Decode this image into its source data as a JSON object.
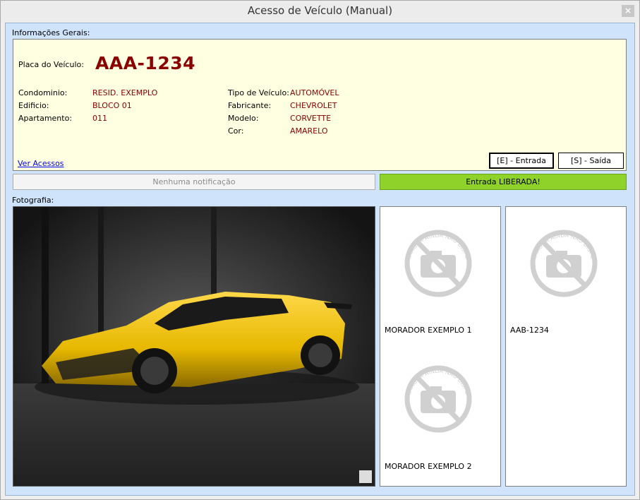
{
  "window": {
    "title": "Acesso de Veículo (Manual)",
    "close_label": "×"
  },
  "info": {
    "section_label": "Informações Gerais:",
    "plate_label": "Placa do Veículo:",
    "plate_value": "AAA-1234",
    "left_fields": [
      {
        "label": "Condominio:",
        "value": "RESID. EXEMPLO"
      },
      {
        "label": "Edificio:",
        "value": "BLOCO 01"
      },
      {
        "label": "Apartamento:",
        "value": "011"
      }
    ],
    "right_fields": [
      {
        "label": "Tipo de Veículo:",
        "value": "AUTOMÓVEL"
      },
      {
        "label": "Fabricante:",
        "value": "CHEVROLET"
      },
      {
        "label": "Modelo:",
        "value": "CORVETTE"
      },
      {
        "label": "Cor:",
        "value": "AMARELO"
      }
    ],
    "view_access_link": "Ver Acessos",
    "entry_button": "[E] - Entrada",
    "exit_button": "[S] - Saída"
  },
  "notification": {
    "text": "Nenhuma notificação"
  },
  "status": {
    "text": "Entrada LIBERADA!",
    "color": "#8fd32a"
  },
  "photo": {
    "section_label": "Fotografia:",
    "vehicle_color": "#e6b800"
  },
  "cards": {
    "no_image_text": "IMAGEM AINDA NÃO DISPONÍVEL",
    "residents": [
      "MORADOR EXEMPLO 1",
      "MORADOR EXEMPLO 2"
    ],
    "plate_card_label": "AAB-1234"
  },
  "colors": {
    "accent_red": "#8b0000",
    "info_bg": "#ffffe1",
    "client_bg": "#cfe3fb"
  }
}
